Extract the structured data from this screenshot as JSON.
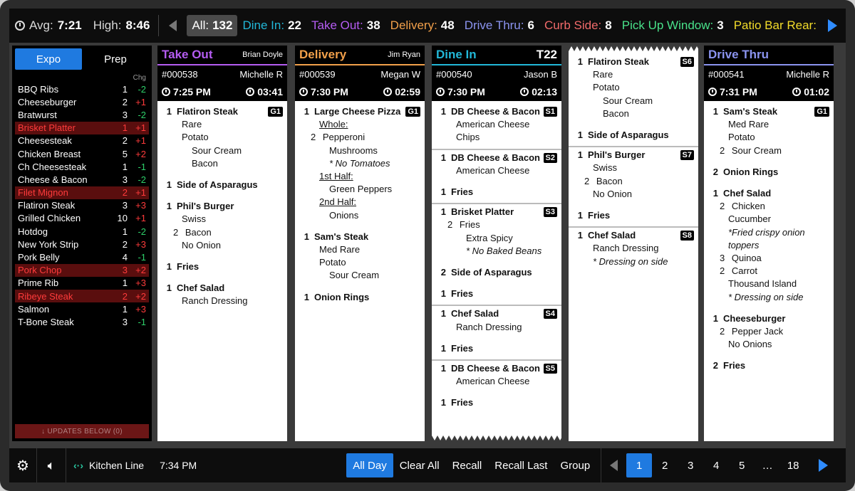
{
  "topbar": {
    "avg_label": "Avg:",
    "avg_value": "7:21",
    "high_label": "High:",
    "high_value": "8:46",
    "filters": [
      {
        "label": "All:",
        "count": "132",
        "color": "#ffffff",
        "active": true
      },
      {
        "label": "Dine In:",
        "count": "22",
        "color": "#22b8d8"
      },
      {
        "label": "Take Out:",
        "count": "38",
        "color": "#b55cf2"
      },
      {
        "label": "Delivery:",
        "count": "48",
        "color": "#f2a04a"
      },
      {
        "label": "Drive Thru:",
        "count": "6",
        "color": "#8b94f0"
      },
      {
        "label": "Curb Side:",
        "count": "8",
        "color": "#f06a6a"
      },
      {
        "label": "Pick Up Window:",
        "count": "3",
        "color": "#49e28a"
      },
      {
        "label": "Patio Bar Rear:",
        "count": "2",
        "color": "#f2dc2a"
      }
    ]
  },
  "leftpanel": {
    "tab_expo": "Expo",
    "tab_prep": "Prep",
    "chg_header": "Chg",
    "items": [
      {
        "name": "BBQ Ribs",
        "qty": "1",
        "chg": "-2",
        "hl": false
      },
      {
        "name": "Cheeseburger",
        "qty": "2",
        "chg": "+1",
        "hl": false
      },
      {
        "name": "Bratwurst",
        "qty": "3",
        "chg": "-2",
        "hl": false
      },
      {
        "name": "Brisket Platter",
        "qty": "1",
        "chg": "+1",
        "hl": true
      },
      {
        "name": "Cheesesteak",
        "qty": "2",
        "chg": "+1",
        "hl": false
      },
      {
        "name": "Chicken Breast",
        "qty": "5",
        "chg": "+2",
        "hl": false
      },
      {
        "name": "Ch Cheesesteak",
        "qty": "1",
        "chg": "-1",
        "hl": false
      },
      {
        "name": "Cheese & Bacon",
        "qty": "3",
        "chg": "-2",
        "hl": false
      },
      {
        "name": "Filet Mignon",
        "qty": "2",
        "chg": "+1",
        "hl": true
      },
      {
        "name": "Flatiron Steak",
        "qty": "3",
        "chg": "+3",
        "hl": false
      },
      {
        "name": "Grilled Chicken",
        "qty": "10",
        "chg": "+1",
        "hl": false
      },
      {
        "name": "Hotdog",
        "qty": "1",
        "chg": "-2",
        "hl": false
      },
      {
        "name": "New York Strip",
        "qty": "2",
        "chg": "+3",
        "hl": false
      },
      {
        "name": "Pork Belly",
        "qty": "4",
        "chg": "-1",
        "hl": false
      },
      {
        "name": "Pork Chop",
        "qty": "3",
        "chg": "+2",
        "hl": true
      },
      {
        "name": "Prime Rib",
        "qty": "1",
        "chg": "+3",
        "hl": false
      },
      {
        "name": "Ribeye Steak",
        "qty": "2",
        "chg": "+2",
        "hl": true
      },
      {
        "name": "Salmon",
        "qty": "1",
        "chg": "+3",
        "hl": false
      },
      {
        "name": "T-Bone Steak",
        "qty": "3",
        "chg": "-1",
        "hl": false
      }
    ],
    "updates_label": "↓ UPDATES BELOW (0)"
  },
  "tickets": [
    {
      "type": "Take Out",
      "color": "#b55cf2",
      "server": "Brian Doyle",
      "table": "",
      "number": "#000538",
      "customer": "Michelle R",
      "time": "7:25 PM",
      "elapsed": "03:41",
      "seats": [
        {
          "badge": "G1",
          "lines": [
            {
              "q": "1",
              "t": "Flatiron Steak",
              "main": true
            },
            {
              "t": "Rare",
              "ind": 1
            },
            {
              "t": "Potato",
              "ind": 1
            },
            {
              "t": "Sour Cream",
              "ind": 2
            },
            {
              "t": "Bacon",
              "ind": 2
            },
            {
              "gap": true
            },
            {
              "q": "1",
              "t": "Side of Asparagus",
              "main": true
            },
            {
              "gap": true
            },
            {
              "q": "1",
              "t": "Phil's Burger",
              "main": true
            },
            {
              "t": "Swiss",
              "ind": 1
            },
            {
              "q2": "2",
              "t": "Bacon",
              "ind": 1
            },
            {
              "t": "No Onion",
              "ind": 1
            },
            {
              "gap": true
            },
            {
              "q": "1",
              "t": "Fries",
              "main": true
            },
            {
              "gap": true
            },
            {
              "q": "1",
              "t": "Chef Salad",
              "main": true
            },
            {
              "t": "Ranch Dressing",
              "ind": 1
            }
          ]
        }
      ]
    },
    {
      "type": "Delivery",
      "color": "#f2a04a",
      "server": "Jim Ryan",
      "table": "",
      "number": "#000539",
      "customer": "Megan W",
      "time": "7:30 PM",
      "elapsed": "02:59",
      "seats": [
        {
          "badge": "G1",
          "lines": [
            {
              "q": "1",
              "t": "Large Cheese Pizza",
              "main": true
            },
            {
              "t": "Whole:",
              "ind": 1,
              "u": true
            },
            {
              "q2": "2",
              "t": "Pepperoni",
              "ind": 1
            },
            {
              "t": "Mushrooms",
              "ind": 2
            },
            {
              "t": "* No Tomatoes",
              "ind": 2,
              "i": true
            },
            {
              "t": "1st Half:",
              "ind": 1,
              "u": true
            },
            {
              "t": "Green Peppers",
              "ind": 2
            },
            {
              "t": "2nd Half:",
              "ind": 1,
              "u": true
            },
            {
              "t": "Onions",
              "ind": 2
            },
            {
              "gap": true
            },
            {
              "q": "1",
              "t": "Sam's Steak",
              "main": true
            },
            {
              "t": "Med Rare",
              "ind": 1
            },
            {
              "t": "Potato",
              "ind": 1
            },
            {
              "t": "Sour Cream",
              "ind": 2
            },
            {
              "gap": true
            },
            {
              "q": "1",
              "t": "Onion Rings",
              "main": true
            }
          ]
        }
      ]
    },
    {
      "type": "Dine In",
      "color": "#22b8d8",
      "server": "",
      "table": "T22",
      "number": "#000540",
      "customer": "Jason B",
      "time": "7:30 PM",
      "elapsed": "02:13",
      "zigzag": true,
      "seats": [
        {
          "badge": "S1",
          "lines": [
            {
              "q": "1",
              "t": "DB Cheese & Bacon",
              "main": true
            },
            {
              "t": "American Cheese",
              "ind": 1
            },
            {
              "t": "Chips",
              "ind": 1
            }
          ]
        },
        {
          "badge": "S2",
          "lines": [
            {
              "q": "1",
              "t": "DB Cheese & Bacon",
              "main": true
            },
            {
              "t": "American Cheese",
              "ind": 1
            },
            {
              "gap": true
            },
            {
              "q": "1",
              "t": "Fries",
              "main": true
            }
          ]
        },
        {
          "badge": "S3",
          "lines": [
            {
              "q": "1",
              "t": "Brisket Platter",
              "main": true
            },
            {
              "q2": "2",
              "t": "Fries",
              "ind": 1
            },
            {
              "t": "Extra Spicy",
              "ind": 2
            },
            {
              "t": "* No Baked Beans",
              "ind": 2,
              "i": true
            },
            {
              "gap": true
            },
            {
              "q": "2",
              "t": "Side of Asparagus",
              "main": true
            },
            {
              "gap": true
            },
            {
              "q": "1",
              "t": "Fries",
              "main": true
            }
          ]
        },
        {
          "badge": "S4",
          "lines": [
            {
              "q": "1",
              "t": "Chef Salad",
              "main": true
            },
            {
              "t": "Ranch Dressing",
              "ind": 1
            },
            {
              "gap": true
            },
            {
              "q": "1",
              "t": "Fries",
              "main": true
            }
          ]
        },
        {
          "badge": "S5",
          "lines": [
            {
              "q": "1",
              "t": "DB Cheese & Bacon",
              "main": true
            },
            {
              "t": "American Cheese",
              "ind": 1
            },
            {
              "gap": true
            },
            {
              "q": "1",
              "t": "Fries",
              "main": true
            }
          ]
        }
      ]
    },
    {
      "type": "",
      "color": "#ffffff",
      "server": "",
      "table": "",
      "number": "",
      "customer": "",
      "time": "",
      "elapsed": "",
      "continuation": true,
      "seats": [
        {
          "badge": "S6",
          "lines": [
            {
              "q": "1",
              "t": "Flatiron Steak",
              "main": true
            },
            {
              "t": "Rare",
              "ind": 1
            },
            {
              "t": "Potato",
              "ind": 1
            },
            {
              "t": "Sour Cream",
              "ind": 2
            },
            {
              "t": "Bacon",
              "ind": 2
            },
            {
              "gap": true
            },
            {
              "q": "1",
              "t": "Side of Asparagus",
              "main": true
            }
          ]
        },
        {
          "badge": "S7",
          "lines": [
            {
              "q": "1",
              "t": "Phil's Burger",
              "main": true
            },
            {
              "t": "Swiss",
              "ind": 1
            },
            {
              "q2": "2",
              "t": "Bacon",
              "ind": 1
            },
            {
              "t": "No Onion",
              "ind": 1
            },
            {
              "gap": true
            },
            {
              "q": "1",
              "t": "Fries",
              "main": true
            }
          ]
        },
        {
          "badge": "S8",
          "lines": [
            {
              "q": "1",
              "t": "Chef Salad",
              "main": true
            },
            {
              "t": "Ranch Dressing",
              "ind": 1
            },
            {
              "t": "* Dressing on side",
              "ind": 1,
              "i": true
            }
          ]
        }
      ]
    },
    {
      "type": "Drive Thru",
      "color": "#8b94f0",
      "server": "",
      "table": "",
      "number": "#000541",
      "customer": "Michelle R",
      "time": "7:31 PM",
      "elapsed": "01:02",
      "seats": [
        {
          "badge": "G1",
          "lines": [
            {
              "q": "1",
              "t": "Sam's Steak",
              "main": true
            },
            {
              "t": "Med Rare",
              "ind": 1
            },
            {
              "t": "Potato",
              "ind": 1
            },
            {
              "q2": "2",
              "t": "Sour Cream",
              "ind": 1
            },
            {
              "gap": true
            },
            {
              "q": "2",
              "t": "Onion Rings",
              "main": true
            },
            {
              "gap": true
            },
            {
              "q": "1",
              "t": "Chef Salad",
              "main": true
            },
            {
              "q2": "2",
              "t": "Chicken",
              "ind": 1
            },
            {
              "t": "Cucumber",
              "ind": 1
            },
            {
              "t": "*Fried crispy onion",
              "ind": 1,
              "i": true
            },
            {
              "t": " toppers",
              "ind": 1,
              "i": true
            },
            {
              "q2": "3",
              "t": "Quinoa",
              "ind": 1
            },
            {
              "q2": "2",
              "t": "Carrot",
              "ind": 1
            },
            {
              "t": "Thousand Island",
              "ind": 1
            },
            {
              "t": "* Dressing on side",
              "ind": 1,
              "i": true
            },
            {
              "gap": true
            },
            {
              "q": "1",
              "t": "Cheeseburger",
              "main": true
            },
            {
              "q2": "2",
              "t": "Pepper Jack",
              "ind": 1
            },
            {
              "t": "No Onions",
              "ind": 1
            },
            {
              "gap": true
            },
            {
              "q": "2",
              "t": "Fries",
              "main": true
            }
          ]
        }
      ]
    }
  ],
  "bottombar": {
    "kitchen_line": "Kitchen Line",
    "clock": "7:34 PM",
    "buttons": [
      "All Day",
      "Clear All",
      "Recall",
      "Recall Last",
      "Group"
    ],
    "active_button": "All Day",
    "pages": [
      "1",
      "2",
      "3",
      "4",
      "5",
      "…",
      "18"
    ],
    "active_page": "1"
  }
}
